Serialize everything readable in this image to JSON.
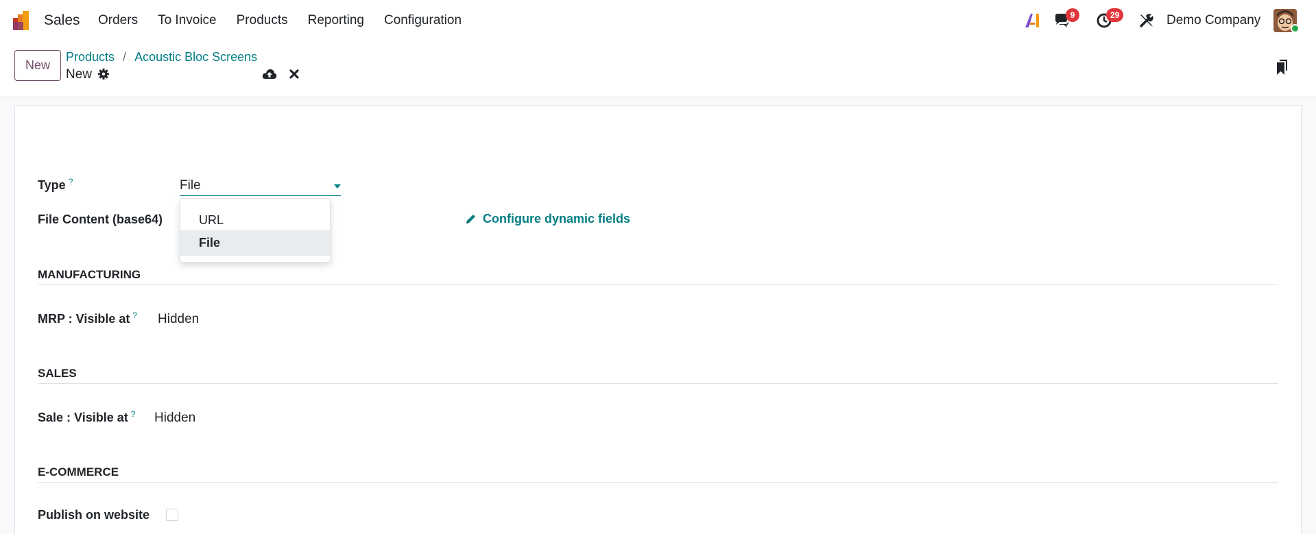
{
  "navbar": {
    "app_name": "Sales",
    "menu": [
      "Orders",
      "To Invoice",
      "Products",
      "Reporting",
      "Configuration"
    ],
    "messages_count": "9",
    "activities_count": "29",
    "company": "Demo Company",
    "icons": [
      "ai-icon",
      "chat-icon",
      "clock-icon",
      "tools-icon"
    ]
  },
  "control_panel": {
    "new_label": "New",
    "breadcrumb": [
      "Products",
      "Acoustic Bloc Screens"
    ],
    "breadcrumb_separator": "/",
    "record_name": "New"
  },
  "form": {
    "type_label": "Type",
    "help_mark": "?",
    "type_value": "File",
    "type_options": [
      "URL",
      "File"
    ],
    "type_selected": "File",
    "file_content_label": "File Content (base64)",
    "configure_link": "Configure dynamic fields",
    "sections": {
      "manufacturing": {
        "title": "MANUFACTURING",
        "field_label": "MRP : Visible at",
        "field_value": "Hidden"
      },
      "sales": {
        "title": "SALES",
        "field_label": "Sale : Visible at",
        "field_value": "Hidden"
      },
      "ecommerce": {
        "title": "E-COMMERCE",
        "field_label": "Publish on website",
        "publish_checked": false
      }
    }
  },
  "colors": {
    "brand": "#714b67",
    "link": "#017e84",
    "badge": "#e0363b"
  }
}
